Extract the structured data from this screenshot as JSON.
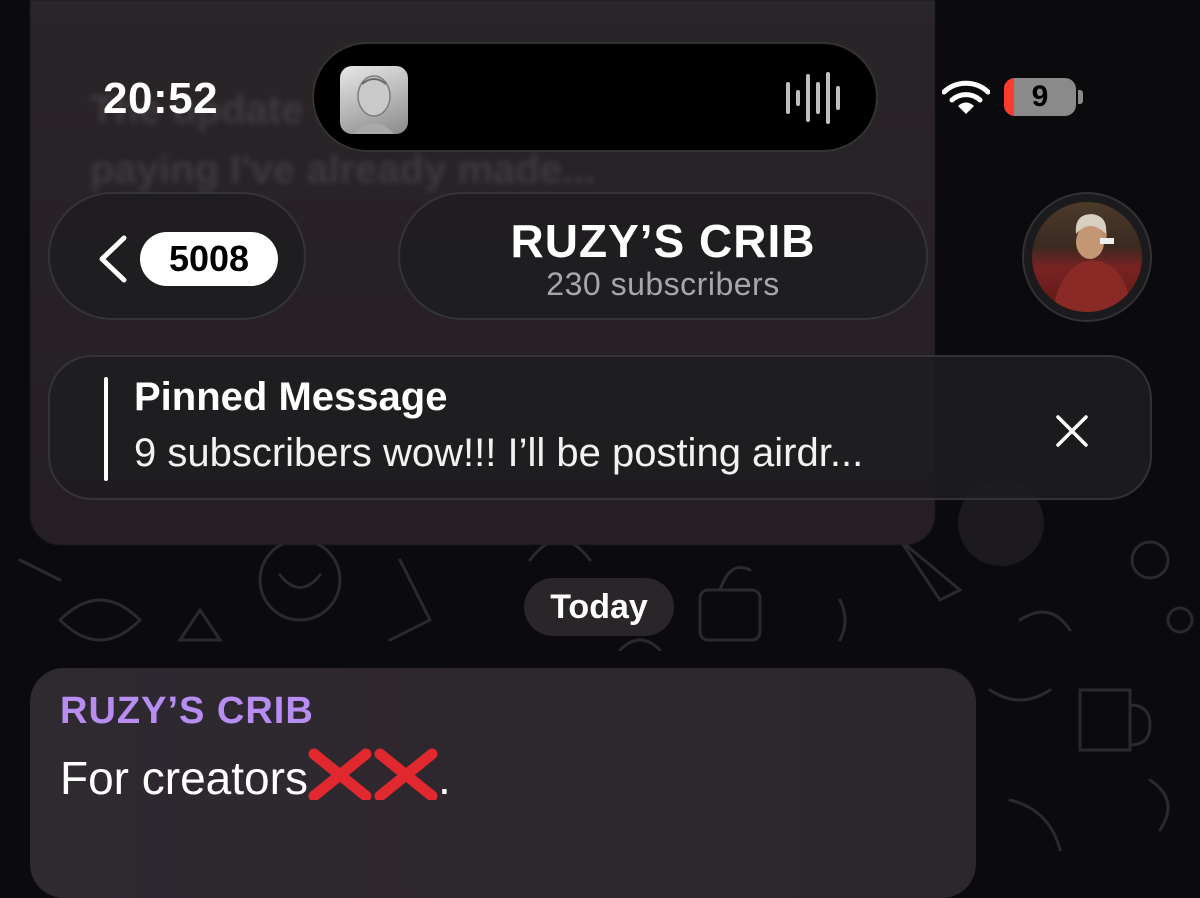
{
  "status_bar": {
    "time": "20:52",
    "battery_level": "9",
    "wifi_icon": "wifi-icon",
    "battery_icon": "battery-icon"
  },
  "header": {
    "back_badge": "5008",
    "title": "RUZY’S CRIB",
    "subtitle": "230 subscribers"
  },
  "background_message": {
    "text": "The update for years plus and it's still paying I've already made..."
  },
  "pinned": {
    "title": "Pinned Message",
    "text": "9 subscribers wow!!! I’ll be posting airdr..."
  },
  "date_separator": "Today",
  "message": {
    "author": "RUZY’S CRIB",
    "text_before": "For creators",
    "emoji": "cross-mark-icon",
    "text_after": "."
  },
  "colors": {
    "author_accent": "#b88df2",
    "battery_low": "#ff3b30",
    "background": "#0b0a0d"
  }
}
